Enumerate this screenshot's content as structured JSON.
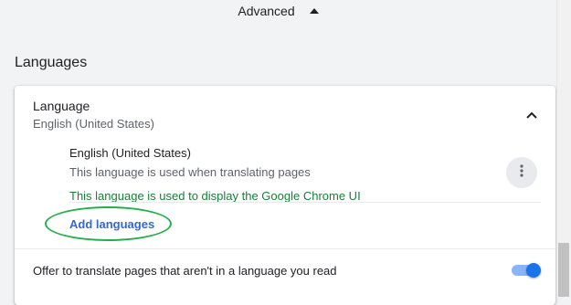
{
  "advanced": {
    "label": "Advanced",
    "icon": "triangle-up-icon"
  },
  "languages_section": {
    "title": "Languages",
    "language": {
      "title": "Language",
      "current": "English (United States)",
      "collapse_icon": "chevron-up-icon"
    },
    "item": {
      "name": "English (United States)",
      "desc_translate": "This language is used when translating pages",
      "desc_ui": "This language is used to display the Google Chrome UI",
      "more_icon": "more-vertical-icon"
    },
    "add_languages": "Add languages",
    "offer_translate": {
      "label": "Offer to translate pages that aren't in a language you read",
      "enabled": true
    }
  },
  "colors": {
    "accent": "#1a73e8",
    "green_text": "#188038",
    "link": "#3367d6",
    "highlight": "#21b04b"
  }
}
